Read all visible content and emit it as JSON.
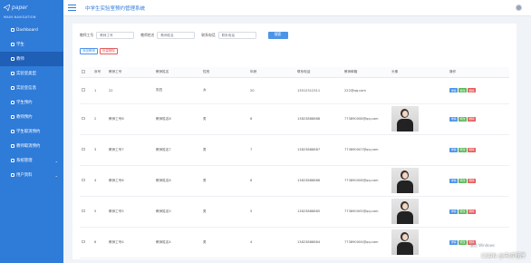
{
  "sidebar": {
    "logo": "paper",
    "nav_title": "MAIN NAVIGATION",
    "items": [
      {
        "label": "Dashboard",
        "active": false,
        "has_chevron": false
      },
      {
        "label": "学生",
        "active": false,
        "has_chevron": false
      },
      {
        "label": "教师",
        "active": true,
        "has_chevron": false
      },
      {
        "label": "实验室类型",
        "active": false,
        "has_chevron": false
      },
      {
        "label": "实验室信息",
        "active": false,
        "has_chevron": false
      },
      {
        "label": "学生预约",
        "active": false,
        "has_chevron": false
      },
      {
        "label": "教师预约",
        "active": false,
        "has_chevron": false
      },
      {
        "label": "学生取消预约",
        "active": false,
        "has_chevron": false
      },
      {
        "label": "教师取消预约",
        "active": false,
        "has_chevron": false
      },
      {
        "label": "系统管理",
        "active": false,
        "has_chevron": true
      },
      {
        "label": "用户资料",
        "active": false,
        "has_chevron": true
      }
    ]
  },
  "header": {
    "title": "中学生实验室预约管理系统"
  },
  "search": {
    "field1_label": "教师工号",
    "field1_placeholder": "教师工号",
    "field2_label": "教师姓名",
    "field2_placeholder": "教师姓名",
    "field3_label": "联系电话",
    "field3_placeholder": "联系电话",
    "button": "搜索"
  },
  "actions": {
    "add": "添加教师",
    "delete": "批量删除"
  },
  "table": {
    "headers": [
      "序号",
      "教师工号",
      "教师姓名",
      "性别",
      "年龄",
      "联系电话",
      "教师邮箱",
      "头像",
      "操作"
    ],
    "op_labels": {
      "view": "详情",
      "edit": "修改",
      "delete": "删除"
    },
    "rows": [
      {
        "no": "1",
        "id": "22",
        "name": "张四",
        "gender": "女",
        "age": "20",
        "phone": "13512312311",
        "email": "222@qq.com",
        "photo": false
      },
      {
        "no": "2",
        "id": "教师工号8",
        "name": "教师姓名8",
        "gender": "男",
        "age": "6",
        "phone": "13823888888",
        "email": "773890008@qq.com",
        "photo": true
      },
      {
        "no": "3",
        "id": "教师工号7",
        "name": "教师姓名7",
        "gender": "男",
        "age": "7",
        "phone": "13823888887",
        "email": "773890007@qq.com",
        "photo": false
      },
      {
        "no": "4",
        "id": "教师工号6",
        "name": "教师姓名6",
        "gender": "男",
        "age": "6",
        "phone": "13823888886",
        "email": "773890006@qq.com",
        "photo": true
      },
      {
        "no": "5",
        "id": "教师工号5",
        "name": "教师姓名5",
        "gender": "男",
        "age": "5",
        "phone": "13823888885",
        "email": "773890005@qq.com",
        "photo": true
      },
      {
        "no": "6",
        "id": "教师工号4",
        "name": "教师姓名4",
        "gender": "男",
        "age": "4",
        "phone": "13823888884",
        "email": "773890004@qq.com",
        "photo": true
      }
    ]
  },
  "overlay": {
    "windows_note": "激活 Windows",
    "watermark": "CSDN @向威程序"
  },
  "colors": {
    "primary": "#2f7bd8",
    "sidebar_active": "#1f5fb5",
    "btn_view": "#4d94e8",
    "btn_edit": "#5cb85c",
    "btn_delete": "#e35d5d"
  }
}
